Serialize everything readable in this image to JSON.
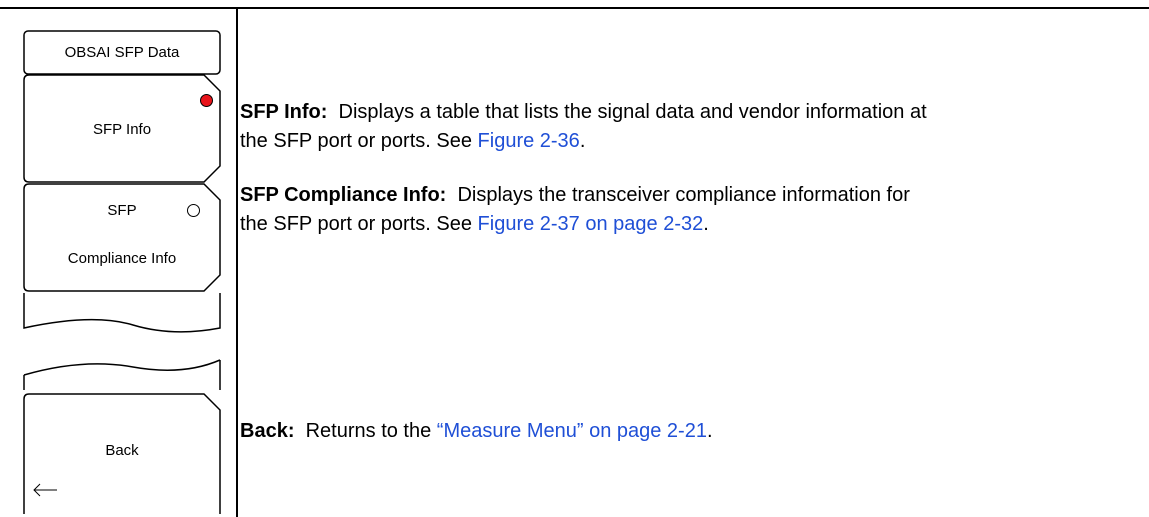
{
  "menu": {
    "title": "OBSAI SFP Data",
    "buttons": [
      {
        "label": "SFP Info",
        "selected": true
      },
      {
        "label_line1": "SFP",
        "label_line2": "Compliance Info",
        "selected": false
      },
      {
        "label": "Back",
        "icon": "left-arrow-icon"
      }
    ]
  },
  "descriptions": {
    "sfp_info": {
      "term": "SFP Info:",
      "text": "Displays a table that lists the signal data and vendor information at",
      "text2": "the SFP port or ports. See ",
      "link": "Figure 2-36",
      "end": "."
    },
    "sfp_compliance": {
      "term": "SFP Compliance Info:",
      "text": "Displays the transceiver compliance information for",
      "text2": "the SFP port or ports. See ",
      "link": "Figure 2-37 on page 2-32",
      "end": "."
    },
    "back": {
      "term": "Back:",
      "text": "Returns to the ",
      "link": "“Measure Menu” on page 2-21",
      "end": "."
    }
  },
  "colors": {
    "selected_led": "#e8141b",
    "link": "#1f4fd6"
  }
}
